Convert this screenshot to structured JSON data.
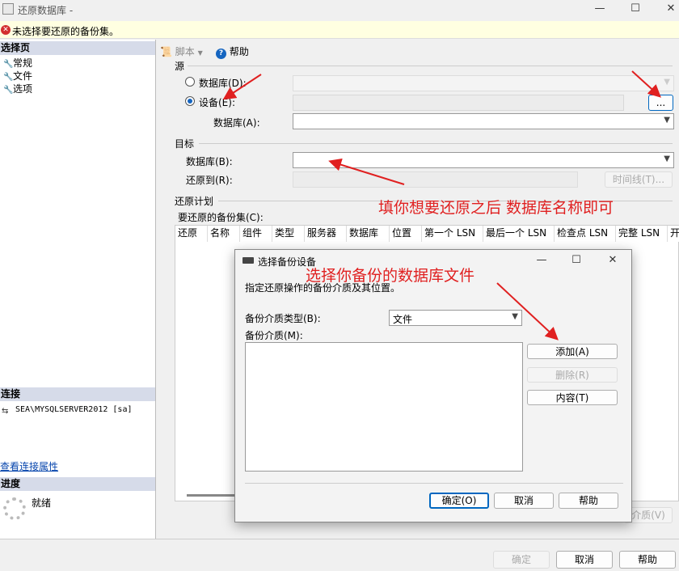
{
  "window": {
    "title": "还原数据库 -",
    "minimize": "—",
    "maximize": "☐",
    "close": "✕"
  },
  "error": {
    "message": "未选择要还原的备份集。"
  },
  "left": {
    "select_page_header": "选择页",
    "pages": [
      {
        "label": "常规"
      },
      {
        "label": "文件"
      },
      {
        "label": "选项"
      }
    ],
    "connection_header": "连接",
    "connection": "SEA\\MYSQLSERVER2012 [sa]",
    "view_connection_props": "查看连接属性",
    "progress_header": "进度",
    "progress_status": "就绪"
  },
  "toolbar": {
    "script": "脚本",
    "help": "帮助"
  },
  "source": {
    "group": "源",
    "database_radio": "数据库(D):",
    "device_radio": "设备(E):",
    "browse": "...",
    "database_label": "数据库(A):"
  },
  "target": {
    "group": "目标",
    "database_label": "数据库(B):",
    "restore_to_label": "还原到(R):",
    "timeline_button": "时间线(T)..."
  },
  "plan": {
    "group": "还原计划",
    "backup_sets_label": "要还原的备份集(C):",
    "columns": [
      "还原",
      "名称",
      "组件",
      "类型",
      "服务器",
      "数据库",
      "位置",
      "第一个 LSN",
      "最后一个 LSN",
      "检查点 LSN",
      "完整 LSN",
      "开"
    ]
  },
  "behind_button": "介质(V)",
  "footer": {
    "ok": "确定",
    "cancel": "取消",
    "help": "帮助"
  },
  "dialog": {
    "title": "选择备份设备",
    "desc": "指定还原操作的备份介质及其位置。",
    "media_type_label": "备份介质类型(B):",
    "media_type_value": "文件",
    "media_label": "备份介质(M):",
    "add": "添加(A)",
    "remove": "删除(R)",
    "contents": "内容(T)",
    "ok": "确定(O)",
    "cancel": "取消",
    "help": "帮助",
    "maximize": "☐",
    "close": "✕"
  },
  "annotations": {
    "target_db": "填你想要还原之后 数据库名称即可",
    "backup_file": "选择你备份的数据库文件"
  },
  "colors": {
    "annotation": "#e02020",
    "error_bg": "#ffffe1",
    "section_header": "#d6dbe9",
    "accent": "#0067c0"
  }
}
